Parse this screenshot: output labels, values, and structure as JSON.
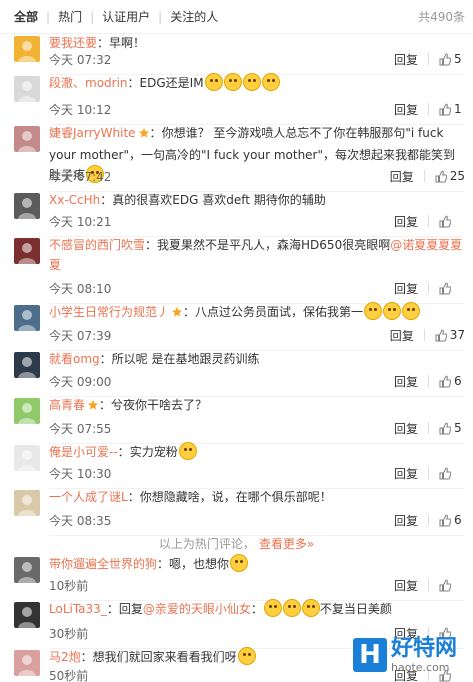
{
  "filter": {
    "tabs": [
      {
        "label": "全部"
      },
      {
        "label": "热门"
      },
      {
        "label": "认证用户"
      },
      {
        "label": "关注的人"
      }
    ],
    "total": "共490条"
  },
  "actions": {
    "reply": "回复"
  },
  "hot_comments": [
    {
      "user": "要我还要",
      "sep": "：",
      "text": "早啊！",
      "time": "今天 07:32",
      "likes": "5",
      "avatar_color": "#f2b233"
    },
    {
      "user": "段澈、modrin",
      "sep": "：",
      "text": "EDG还是IM",
      "emoji_count": 4,
      "time": "今天 10:12",
      "likes": "1",
      "avatar_color": "#d9d9d9"
    },
    {
      "user": "婕睿JarryWhite",
      "sep": "：",
      "text": "你想谁？ 至今游戏喷人总忘不了你在韩服那句\"i fuck your mother\"，一句高冷的\"I fuck your mother\"，每次想起来我都能笑到肚子疼",
      "emoji_count": 1,
      "time": "今天 07:42",
      "likes": "25",
      "avatar_color": "#c28a8a",
      "has_badge": true
    },
    {
      "user": "Xx-CcHh",
      "sep": "：",
      "text": "真的很喜欢EDG 喜欢deft 期待你的辅助",
      "time": "今天 10:21",
      "likes": "",
      "avatar_color": "#5b5b5b"
    },
    {
      "user": "不感冒的西门吹雪",
      "sep": "：",
      "text": "我夏果然不是平凡人，森海HD650很亮眼啊",
      "mention": "@诺夏夏夏夏夏",
      "time": "今天 08:10",
      "likes": "",
      "avatar_color": "#7a2e2e"
    },
    {
      "user": "小学生日常行为规范丿",
      "sep": "：",
      "text": "八点过公务员面试，保佑我第一",
      "emoji_count": 3,
      "time": "今天 07:39",
      "likes": "37",
      "avatar_color": "#4d6e8a",
      "has_badge": true
    },
    {
      "user": "就看omg",
      "sep": "：",
      "text": "所以呢 是在基地跟灵药训练",
      "time": "今天 09:00",
      "likes": "6",
      "avatar_color": "#2d3a4a"
    },
    {
      "user": "高青春",
      "sep": "：",
      "text": "兮夜你干啥去了？",
      "time": "今天 07:55",
      "likes": "5",
      "avatar_color": "#8fc96a",
      "has_badge": true
    },
    {
      "user": "俺是小可爱--",
      "sep": "：",
      "text": "实力宠粉",
      "emoji_count": 1,
      "time": "今天 10:30",
      "likes": "",
      "avatar_color": "#e8e8e8"
    },
    {
      "user": "一个人成了谜L",
      "sep": "：",
      "text": "你想隐藏啥，说，在哪个俱乐部呢！",
      "time": "今天 08:35",
      "likes": "6",
      "avatar_color": "#d9c9a8"
    }
  ],
  "section_separator": {
    "text": "以上为热门评论，",
    "more": "查看更多»"
  },
  "recent_comments": [
    {
      "user": "带你遛遍全世界的狗",
      "sep": "：",
      "text": "嗯，也想你",
      "emoji_count": 1,
      "time": "10秒前",
      "likes": "",
      "avatar_color": "#6a6a6a"
    },
    {
      "user": "LoLiTa33_",
      "sep": "：",
      "text": "回复",
      "mention": "@亲爱的天眼小仙女",
      "text2": "：",
      "text3": "不复当日美颜",
      "emoji_count": 3,
      "time": "30秒前",
      "likes": "",
      "avatar_color": "#333333"
    },
    {
      "user": "马2炮",
      "sep": "：",
      "text": "想我们就回家来看看我们呀",
      "emoji_count": 1,
      "time": "50秒前",
      "likes": "",
      "avatar_color": "#d9a0a0"
    }
  ],
  "watermark": {
    "logo": "H",
    "title": "好特网",
    "url": "haote.com"
  }
}
